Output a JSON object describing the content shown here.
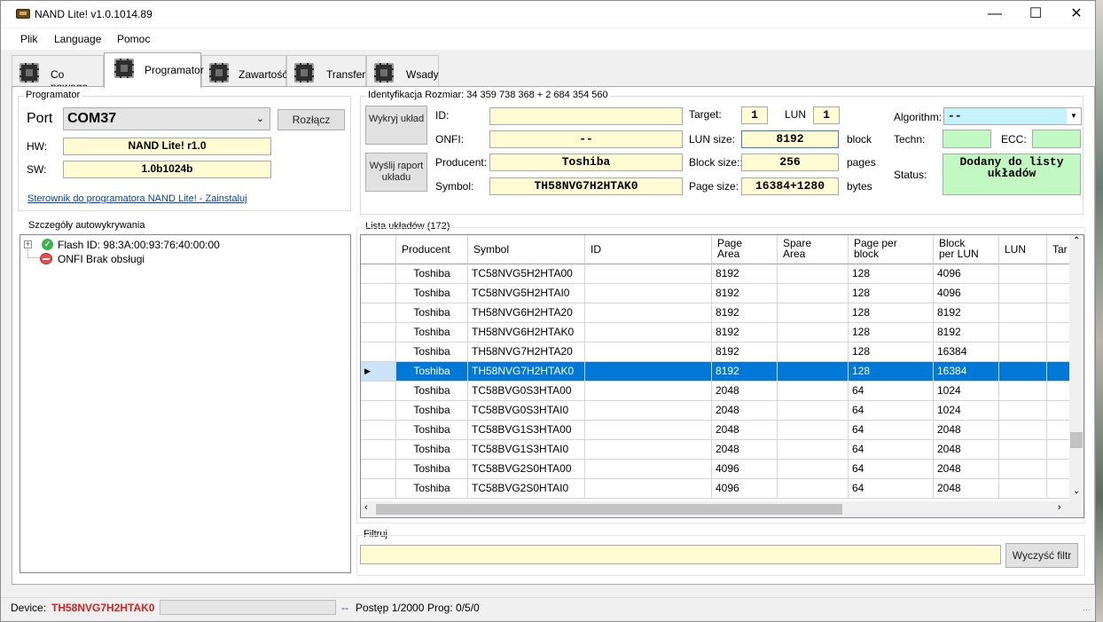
{
  "window": {
    "title": "NAND Lite! v1.0.1014.89",
    "minimize": "—",
    "maximize": "☐",
    "close": "✕"
  },
  "menu": [
    "Plik",
    "Language",
    "Pomoc"
  ],
  "tabs": [
    "Co nowego",
    "Programator",
    "Zawartość",
    "Transfer",
    "Wsady"
  ],
  "programator": {
    "legend": "Programator",
    "port_label": "Port",
    "port_value": "COM37",
    "disconnect": "Rozłącz",
    "hw_label": "HW:",
    "hw_value": "NAND Lite! r1.0",
    "sw_label": "SW:",
    "sw_value": "1.0b1024b",
    "driver_link": "Sterownik do programatora NAND Lite! - Zainstaluj"
  },
  "ident": {
    "legend": "Identyfikacja Rozmiar: 34 359 738 368 + 2 684 354 560",
    "detect_btn": "Wykryj układ",
    "report_btn": "Wyślij raport układu",
    "id_label": "ID:",
    "id_value": "",
    "onfi_label": "ONFI:",
    "onfi_value": "--",
    "producer_label": "Producent:",
    "producer_value": "Toshiba",
    "symbol_label": "Symbol:",
    "symbol_value": "TH58NVG7H2HTAK0",
    "target_label": "Target:",
    "target_value": "1",
    "lun_label": "LUN",
    "lun_value": "1",
    "lunsize_label": "LUN size:",
    "lunsize_value": "8192",
    "lunsize_unit": "block",
    "blocksize_label": "Block size::",
    "blocksize_value": "256",
    "blocksize_unit": "pages",
    "pagesize_label": "Page size:",
    "pagesize_value": "16384+1280",
    "pagesize_unit": "bytes",
    "algorithm_label": "Algorithm:",
    "algorithm_value": "--",
    "techn_label": "Techn:",
    "ecc_label": "ECC:",
    "status_label": "Status:",
    "status_value": "Dodany do listy układów"
  },
  "autodetect": {
    "legend": "Szczegóły autowykrywania",
    "items": [
      {
        "label": "Flash ID: 98:3A:00:93:76:40:00:00",
        "icon": "check-circle-icon"
      },
      {
        "label": "ONFI Brak obsługi",
        "icon": "no-entry-icon"
      }
    ]
  },
  "chiplist": {
    "legend": "Lista układów (172)",
    "headers": [
      "Producent",
      "Symbol",
      "ID",
      "Page\nArea",
      "Spare\nArea",
      "Page per\nblock",
      "Block\nper LUN",
      "LUN",
      "Tar"
    ],
    "rows": [
      [
        "Toshiba",
        "TC58NVG5H2HTA00",
        "",
        "8192",
        "",
        "128",
        "4096"
      ],
      [
        "Toshiba",
        "TC58NVG5H2HTAI0",
        "",
        "8192",
        "",
        "128",
        "4096"
      ],
      [
        "Toshiba",
        "TH58NVG6H2HTA20",
        "",
        "8192",
        "",
        "128",
        "8192"
      ],
      [
        "Toshiba",
        "TH58NVG6H2HTAK0",
        "",
        "8192",
        "",
        "128",
        "8192"
      ],
      [
        "Toshiba",
        "TH58NVG7H2HTA20",
        "",
        "8192",
        "",
        "128",
        "16384"
      ],
      [
        "Toshiba",
        "TH58NVG7H2HTAK0",
        "",
        "8192",
        "",
        "128",
        "16384"
      ],
      [
        "Toshiba",
        "TC58BVG0S3HTA00",
        "",
        "2048",
        "",
        "64",
        "1024"
      ],
      [
        "Toshiba",
        "TC58BVG0S3HTAI0",
        "",
        "2048",
        "",
        "64",
        "1024"
      ],
      [
        "Toshiba",
        "TC58BVG1S3HTA00",
        "",
        "2048",
        "",
        "64",
        "2048"
      ],
      [
        "Toshiba",
        "TC58BVG1S3HTAI0",
        "",
        "2048",
        "",
        "64",
        "2048"
      ],
      [
        "Toshiba",
        "TC58BVG2S0HTA00",
        "",
        "4096",
        "",
        "64",
        "2048"
      ],
      [
        "Toshiba",
        "TC58BVG2S0HTAI0",
        "",
        "4096",
        "",
        "64",
        "2048"
      ]
    ],
    "selected_row": 5
  },
  "filter": {
    "legend": "Filtruj",
    "value": "",
    "clear_btn": "Wyczyść filtr"
  },
  "statusbar": {
    "device_label": "Device:",
    "device_value": "TH58NVG7H2HTAK0",
    "sep": "--",
    "progress": "Postęp 1/2000",
    "prog": "Prog: 0/5/0"
  }
}
